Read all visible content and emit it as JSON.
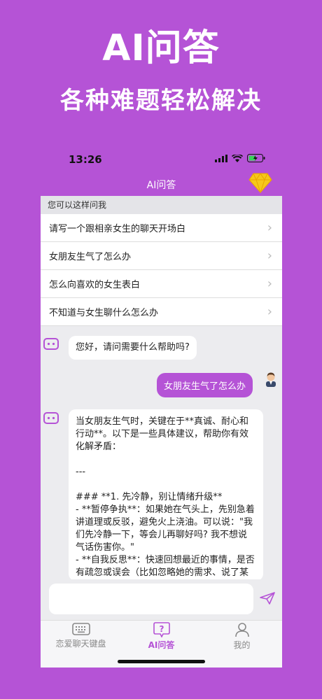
{
  "promo": {
    "title": "AI问答",
    "subtitle": "各种难题轻松解决"
  },
  "status_bar": {
    "time": "13:26"
  },
  "nav": {
    "title": "AI问答",
    "premium_icon": "diamond-icon"
  },
  "suggestions": {
    "header": "您可以这样问我",
    "items": [
      {
        "label": "请写一个跟相亲女生的聊天开场白"
      },
      {
        "label": "女朋友生气了怎么办"
      },
      {
        "label": "怎么向喜欢的女生表白"
      },
      {
        "label": "不知道与女生聊什么怎么办"
      }
    ]
  },
  "chat": {
    "greeting": "您好，请问需要什么帮助吗?",
    "user_message": "女朋友生气了怎么办",
    "answer": "当女朋友生气时，关键在于**真诚、耐心和行动**。以下是一些具体建议，帮助你有效化解矛盾：\n\n---\n\n### **1. 先冷静，别让情绪升级**\n- **暂停争执**：如果她在气头上，先别急着讲道理或反驳，避免火上浇油。可以说：\"我们先冷静一下，等会儿再聊好吗? 我不想说气话伤害你。\"\n- **自我反思**：快速回想最近的事情，是否有疏忽或误会（比如忽略她的需求、说了某句话等）。"
  },
  "input": {
    "placeholder": ""
  },
  "tabs": [
    {
      "label": "恋爱聊天键盘",
      "icon": "keyboard-icon",
      "active": false
    },
    {
      "label": "AI问答",
      "icon": "question-icon",
      "active": true
    },
    {
      "label": "我的",
      "icon": "person-icon",
      "active": false
    }
  ],
  "colors": {
    "accent": "#B553D6",
    "background": "#ECECEF"
  }
}
